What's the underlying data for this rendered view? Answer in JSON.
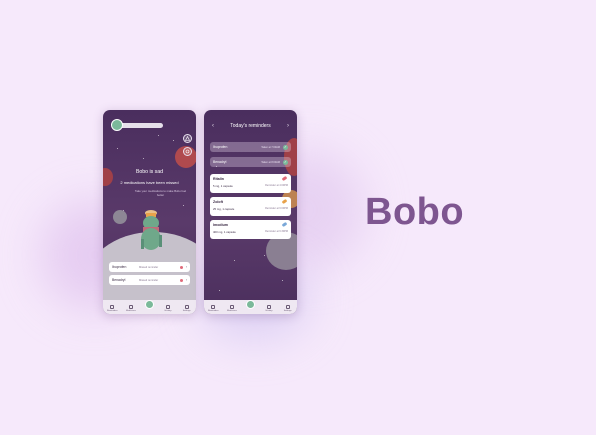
{
  "brand": {
    "name": "Bobo"
  },
  "screen_home": {
    "status": {
      "title": "Bobo is sad",
      "subtitle": "2 medications have been missed",
      "hint": "Take your medications to make Bobo feel better"
    },
    "missed": [
      {
        "name": "Ibuprofen",
        "status": "Missed reminder"
      },
      {
        "name": "Benadryl",
        "status": "Missed reminder"
      }
    ]
  },
  "screen_reminders": {
    "title": "Today's reminders",
    "taken": [
      {
        "name": "Ibuprofen",
        "status": "Taken at 7:00AM"
      },
      {
        "name": "Benadryl",
        "status": "Taken at 8:00AM"
      }
    ],
    "upcoming": [
      {
        "name": "Ritalin",
        "dose": "5 mg, 1 capsule",
        "time": "Reminder at 4:00PM",
        "pill_color": "#e06b7a"
      },
      {
        "name": "Zoloft",
        "dose": "25 mg, 1 capsule",
        "time": "Reminder at 6:00PM",
        "pill_color": "#e8a24a"
      },
      {
        "name": "Imodium",
        "dose": "400 mg, 1 capsule",
        "time": "Reminder at 6:30PM",
        "pill_color": "#7aa8d8"
      }
    ]
  },
  "nav": [
    "Reminders",
    "Medicines",
    "",
    "History",
    "Settings"
  ],
  "colors": {
    "accent": "#7bb99a",
    "brand": "#7e5690",
    "missed": "#e06b7a",
    "background": "#f6e9fb"
  }
}
